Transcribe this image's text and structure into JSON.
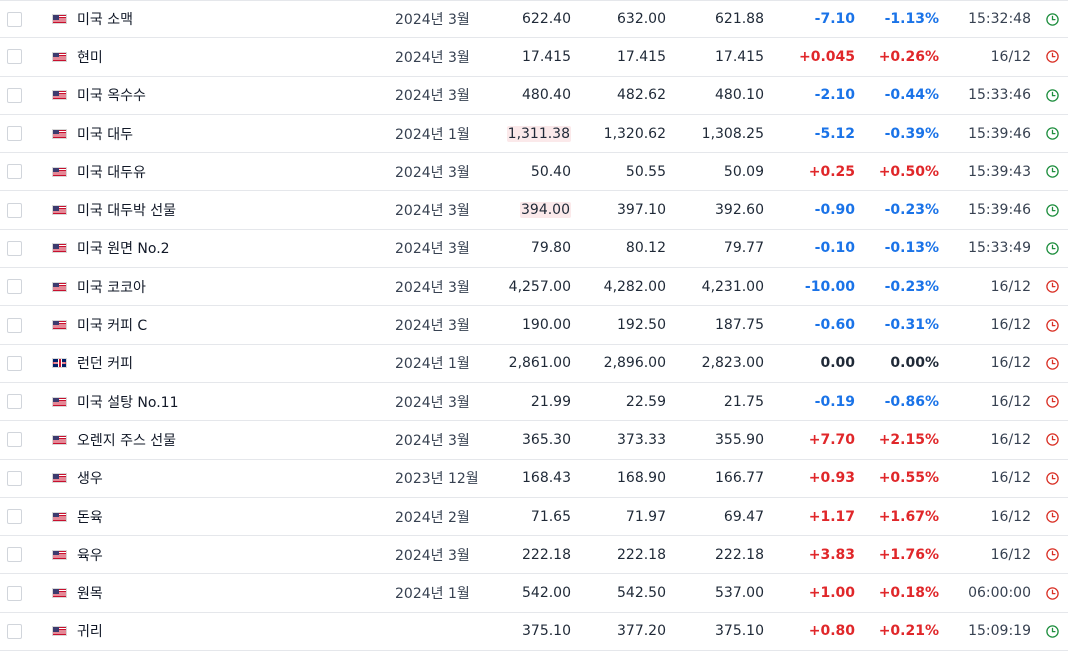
{
  "colors": {
    "positive": "#e0272a",
    "negative": "#1a73e8",
    "neutral": "#1f2937",
    "clock_open": "#1e8e3e",
    "clock_closed": "#d93025",
    "highlight_bg": "#fbe9ea"
  },
  "rows": [
    {
      "flag": "us-flag-icon",
      "name": "미국 소맥",
      "month": "2024년 3월",
      "last": "622.40",
      "high": "632.00",
      "low": "621.88",
      "change": "-7.10",
      "change_pct": "-1.13%",
      "time": "15:32:48",
      "dir": "neg",
      "clock": "open",
      "last_highlight": false
    },
    {
      "flag": "us-flag-icon",
      "name": "현미",
      "month": "2024년 3월",
      "last": "17.415",
      "high": "17.415",
      "low": "17.415",
      "change": "+0.045",
      "change_pct": "+0.26%",
      "time": "16/12",
      "dir": "pos",
      "clock": "closed",
      "last_highlight": false
    },
    {
      "flag": "us-flag-icon",
      "name": "미국 옥수수",
      "month": "2024년 3월",
      "last": "480.40",
      "high": "482.62",
      "low": "480.10",
      "change": "-2.10",
      "change_pct": "-0.44%",
      "time": "15:33:46",
      "dir": "neg",
      "clock": "open",
      "last_highlight": false
    },
    {
      "flag": "us-flag-icon",
      "name": "미국 대두",
      "month": "2024년 1월",
      "last": "1,311.38",
      "high": "1,320.62",
      "low": "1,308.25",
      "change": "-5.12",
      "change_pct": "-0.39%",
      "time": "15:39:46",
      "dir": "neg",
      "clock": "open",
      "last_highlight": true
    },
    {
      "flag": "us-flag-icon",
      "name": "미국 대두유",
      "month": "2024년 3월",
      "last": "50.40",
      "high": "50.55",
      "low": "50.09",
      "change": "+0.25",
      "change_pct": "+0.50%",
      "time": "15:39:43",
      "dir": "pos",
      "clock": "open",
      "last_highlight": false
    },
    {
      "flag": "us-flag-icon",
      "name": "미국 대두박 선물",
      "month": "2024년 3월",
      "last": "394.00",
      "high": "397.10",
      "low": "392.60",
      "change": "-0.90",
      "change_pct": "-0.23%",
      "time": "15:39:46",
      "dir": "neg",
      "clock": "open",
      "last_highlight": true
    },
    {
      "flag": "us-flag-icon",
      "name": "미국 원면 No.2",
      "month": "2024년 3월",
      "last": "79.80",
      "high": "80.12",
      "low": "79.77",
      "change": "-0.10",
      "change_pct": "-0.13%",
      "time": "15:33:49",
      "dir": "neg",
      "clock": "open",
      "last_highlight": false
    },
    {
      "flag": "us-flag-icon",
      "name": "미국 코코아",
      "month": "2024년 3월",
      "last": "4,257.00",
      "high": "4,282.00",
      "low": "4,231.00",
      "change": "-10.00",
      "change_pct": "-0.23%",
      "time": "16/12",
      "dir": "neg",
      "clock": "closed",
      "last_highlight": false
    },
    {
      "flag": "us-flag-icon",
      "name": "미국 커피 C",
      "month": "2024년 3월",
      "last": "190.00",
      "high": "192.50",
      "low": "187.75",
      "change": "-0.60",
      "change_pct": "-0.31%",
      "time": "16/12",
      "dir": "neg",
      "clock": "closed",
      "last_highlight": false
    },
    {
      "flag": "uk-flag-icon",
      "name": "런던 커피",
      "month": "2024년 1월",
      "last": "2,861.00",
      "high": "2,896.00",
      "low": "2,823.00",
      "change": "0.00",
      "change_pct": "0.00%",
      "time": "16/12",
      "dir": "zero",
      "clock": "closed",
      "last_highlight": false
    },
    {
      "flag": "us-flag-icon",
      "name": "미국 설탕 No.11",
      "month": "2024년 3월",
      "last": "21.99",
      "high": "22.59",
      "low": "21.75",
      "change": "-0.19",
      "change_pct": "-0.86%",
      "time": "16/12",
      "dir": "neg",
      "clock": "closed",
      "last_highlight": false
    },
    {
      "flag": "us-flag-icon",
      "name": "오렌지 주스 선물",
      "month": "2024년 3월",
      "last": "365.30",
      "high": "373.33",
      "low": "355.90",
      "change": "+7.70",
      "change_pct": "+2.15%",
      "time": "16/12",
      "dir": "pos",
      "clock": "closed",
      "last_highlight": false
    },
    {
      "flag": "us-flag-icon",
      "name": "생우",
      "month": "2023년 12월",
      "last": "168.43",
      "high": "168.90",
      "low": "166.77",
      "change": "+0.93",
      "change_pct": "+0.55%",
      "time": "16/12",
      "dir": "pos",
      "clock": "closed",
      "last_highlight": false
    },
    {
      "flag": "us-flag-icon",
      "name": "돈육",
      "month": "2024년 2월",
      "last": "71.65",
      "high": "71.97",
      "low": "69.47",
      "change": "+1.17",
      "change_pct": "+1.67%",
      "time": "16/12",
      "dir": "pos",
      "clock": "closed",
      "last_highlight": false
    },
    {
      "flag": "us-flag-icon",
      "name": "육우",
      "month": "2024년 3월",
      "last": "222.18",
      "high": "222.18",
      "low": "222.18",
      "change": "+3.83",
      "change_pct": "+1.76%",
      "time": "16/12",
      "dir": "pos",
      "clock": "closed",
      "last_highlight": false
    },
    {
      "flag": "us-flag-icon",
      "name": "원목",
      "month": "2024년 1월",
      "last": "542.00",
      "high": "542.50",
      "low": "537.00",
      "change": "+1.00",
      "change_pct": "+0.18%",
      "time": "06:00:00",
      "dir": "pos",
      "clock": "closed",
      "last_highlight": false
    },
    {
      "flag": "us-flag-icon",
      "name": "귀리",
      "month": "",
      "last": "375.10",
      "high": "377.20",
      "low": "375.10",
      "change": "+0.80",
      "change_pct": "+0.21%",
      "time": "15:09:19",
      "dir": "pos",
      "clock": "open",
      "last_highlight": false
    }
  ]
}
